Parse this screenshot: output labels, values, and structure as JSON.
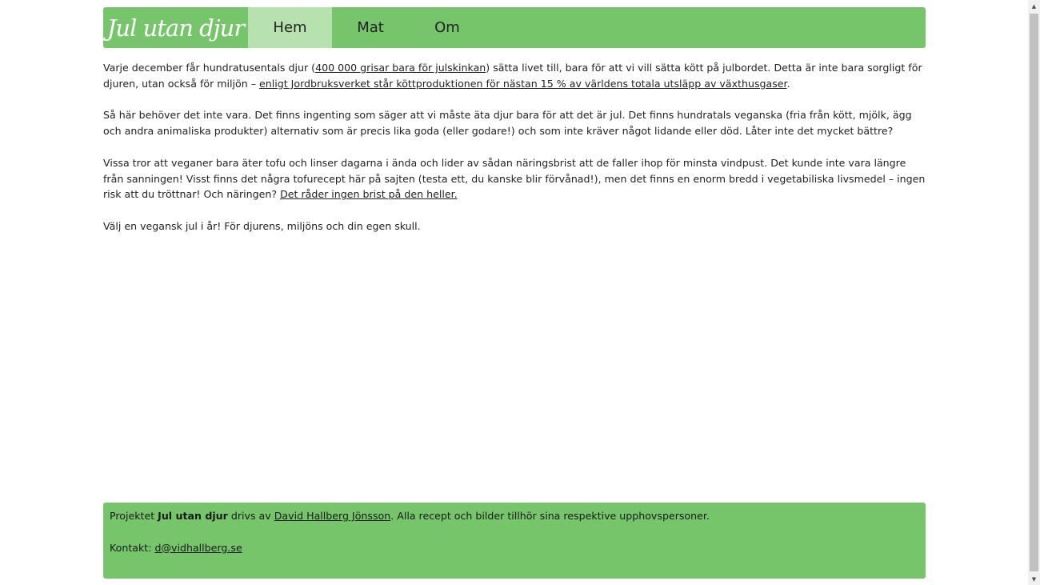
{
  "header": {
    "logo": "Jul utan djur",
    "nav": [
      {
        "label": "Hem",
        "active": true
      },
      {
        "label": "Mat",
        "active": false
      },
      {
        "label": "Om",
        "active": false
      }
    ]
  },
  "content": {
    "p1": {
      "t1": "Varje december får hundratusentals djur (",
      "link1": "400 000 grisar bara för julskinkan",
      "t2": ") sätta livet till, bara för att vi vill sätta kött på julbordet. Detta är inte bara sorgligt för djuren, utan också för miljön – ",
      "link2": "enligt Jordbruksverket står köttproduktionen för nästan 15 % av världens totala utsläpp av växthusgaser",
      "t3": "."
    },
    "p2": "Så här behöver det inte vara. Det finns ingenting som säger att vi måste äta djur bara för att det är jul. Det finns hundratals veganska (fria från kött, mjölk, ägg och andra animaliska produkter) alternativ som är precis lika goda (eller godare!) och som inte kräver något lidande eller död. Låter inte det mycket bättre?",
    "p3": {
      "t1": "Vissa tror att veganer bara äter tofu och linser dagarna i ända och lider av sådan näringsbrist att de faller ihop för minsta vindpust. Det kunde inte vara längre från sanningen! Visst finns det några tofurecept här på sajten (testa ett, du kanske blir förvånad!), men det finns en enorm bredd i vegetabiliska livsmedel – ingen risk att du tröttnar! Och näringen? ",
      "link": "Det råder ingen brist på den heller."
    },
    "p4": "Välj en vegansk jul i år! För djurens, miljöns och din egen skull."
  },
  "footer": {
    "t1": "Projektet ",
    "project_name": "Jul utan djur",
    "t2": " drivs av ",
    "author_link": "David Hallberg Jönsson",
    "t3": ". Alla recept och bilder tillhör sina respektive upphovspersoner.",
    "contact_label": "Kontakt: ",
    "contact_link": "d@vidhallberg.se"
  },
  "scrollbar": {
    "up_arrow": "▲",
    "down_arrow": "▼"
  },
  "colors": {
    "header_green": "#76c56b",
    "active_tab": "#b7e2af"
  }
}
